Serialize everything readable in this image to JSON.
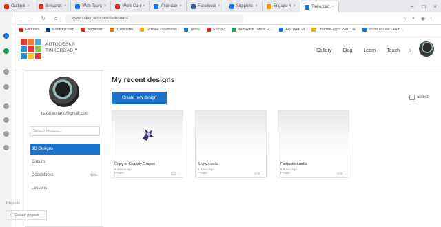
{
  "browser": {
    "tabs": [
      {
        "label": "Outlook",
        "color": "#d93025"
      },
      {
        "label": "Servants",
        "color": "#d93025"
      },
      {
        "label": "Web Team",
        "color": "#1a73e8"
      },
      {
        "label": "Work Cou",
        "color": "#d93025"
      },
      {
        "label": "Attendan",
        "color": "#1a73e8"
      },
      {
        "label": "Facebook",
        "color": "#3b5998"
      },
      {
        "label": "Supporte",
        "color": "#1a73e8"
      },
      {
        "label": "Engage h",
        "color": "#f29900"
      },
      {
        "label": "Tinkercad",
        "color": "#1b72c9"
      }
    ],
    "url": "www.tinkercad.com/dashboard",
    "bookmarks": [
      {
        "label": "Pictures",
        "color": "#d93025"
      },
      {
        "label": "Booking.com",
        "color": "#003580"
      },
      {
        "label": "Applecart",
        "color": "#d93025"
      },
      {
        "label": "Thespider",
        "color": "#e37400"
      },
      {
        "label": "Scrolite Download",
        "color": "#f9ab00"
      },
      {
        "label": "Tsotsi",
        "color": "#1a73e8"
      },
      {
        "label": "Supply",
        "color": "#d93025"
      },
      {
        "label": "Red Rock Tahoe R...",
        "color": "#0f9d58"
      },
      {
        "label": "AIS Web M",
        "color": "#1a73e8"
      },
      {
        "label": "Dharma-Light Web Da",
        "color": "#f9ab00"
      },
      {
        "label": "Mood House - Run...",
        "color": "#1a73e8"
      }
    ]
  },
  "header": {
    "brand_line1": "AUTODESK®",
    "brand_line2": "TINKERCAD™",
    "nav": [
      "Gallery",
      "Blog",
      "Learn",
      "Teach"
    ],
    "logo_colors": [
      "#e2393b",
      "#e9832d",
      "#5aa3d6",
      "#2f8dcd",
      "#e2393b",
      "#8dc63f",
      "#2f8dcd",
      "#f7c22e",
      "#e2393b"
    ]
  },
  "sidebar": {
    "email": "hazel.soriano@gmail.com",
    "search_placeholder": "Search designs...",
    "items": [
      {
        "label": "3D Designs",
        "count": ""
      },
      {
        "label": "Circuits",
        "count": ""
      },
      {
        "label": "Codeblocks",
        "count": "beta"
      },
      {
        "label": "Lessons",
        "count": ""
      }
    ],
    "section_label": "Projects",
    "create_project": "Create project"
  },
  "main": {
    "title": "My recent designs",
    "create_button": "Create new design",
    "select_label": "Select",
    "designs": [
      {
        "name": "Copy of Snazzly Grapes",
        "meta1": "a minute ago",
        "meta2": "Private",
        "badge": "Edit  ..."
      },
      {
        "name": "Shiny Luulia",
        "meta1": "5 hours ago",
        "meta2": "Private",
        "badge": "Edit  ..."
      },
      {
        "name": "Fantastic Luulia",
        "meta1": "5 hours ago",
        "meta2": "Private",
        "badge": "Edit  ..."
      }
    ]
  }
}
